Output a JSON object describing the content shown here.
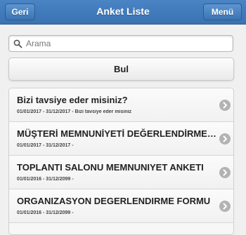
{
  "header": {
    "back_label": "Geri",
    "title": "Anket Liste",
    "menu_label": "Menü"
  },
  "search": {
    "placeholder": "Arama",
    "value": "",
    "icon": "search-icon"
  },
  "find_button": {
    "label": "Bul"
  },
  "surveys": [
    {
      "title": "Bizi tavsiye eder misiniz?",
      "subtitle": "01/01/2017 - 31/12/2017 - Bizi tavsiye eder misiniz"
    },
    {
      "title": "MÜŞTERİ MEMNUNİYETİ DEĞERLENDİRME ANKETİ",
      "subtitle": "01/01/2017 - 31/12/2017 -"
    },
    {
      "title": "TOPLANTI SALONU MEMNUNIYET ANKETI",
      "subtitle": "01/01/2016 - 31/12/2099 -"
    },
    {
      "title": "ORGANIZASYON DEGERLENDIRME FORMU",
      "subtitle": "01/01/2016 - 31/12/2099 -"
    }
  ],
  "colors": {
    "header": "#3a72b3",
    "chevron": "#b3b3b3"
  }
}
